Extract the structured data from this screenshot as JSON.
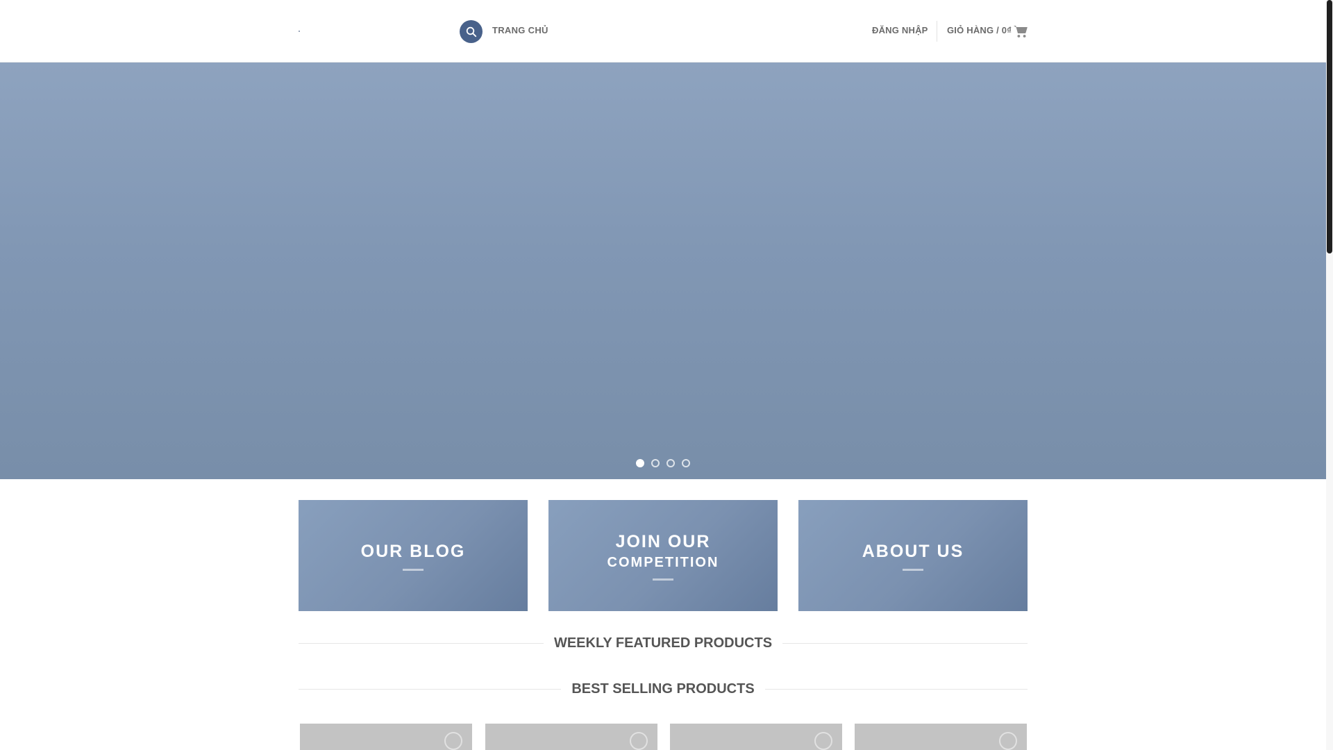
{
  "header": {
    "nav_home": "TRANG CHỦ",
    "login": "ĐĂNG NHẬP",
    "cart": "GIỎ HÀNG / 0₫"
  },
  "icons": {
    "search": "search-icon",
    "cart": "cart-icon",
    "wishlist": "heart-icon"
  },
  "hero": {
    "slide_count": 4,
    "active_slide": 1,
    "dots": [
      "slide 1",
      "slide 2",
      "slide 3",
      "slide 4"
    ]
  },
  "promos": [
    {
      "title": "OUR BLOG",
      "subtitle": ""
    },
    {
      "title": "JOIN OUR",
      "subtitle": "COMPETITION"
    },
    {
      "title": "ABOUT US",
      "subtitle": ""
    }
  ],
  "sections": {
    "weekly_featured": "WEEKLY FEATURED PRODUCTS",
    "best_selling": "BEST SELLING PRODUCTS"
  },
  "colors": {
    "accent": "#48618a",
    "hero": "#8197b4",
    "promo": "#7b91b0",
    "placeholder": "#c3c3c3"
  }
}
